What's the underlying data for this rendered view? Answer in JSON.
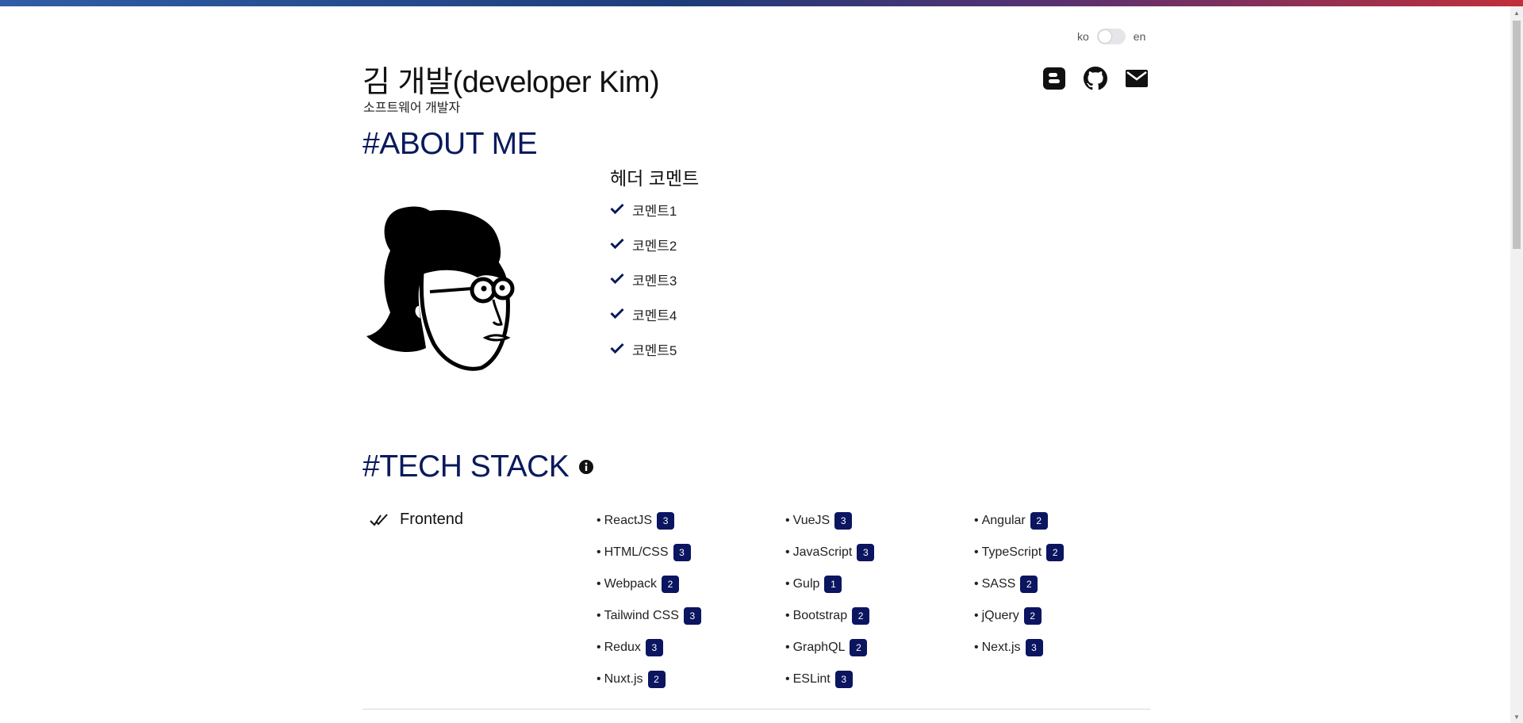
{
  "language": {
    "left": "ko",
    "right": "en"
  },
  "profile": {
    "name": "김 개발(developer Kim)",
    "subtitle": "소프트웨어 개발자"
  },
  "social": [
    {
      "icon": "blogger-icon"
    },
    {
      "icon": "github-icon"
    },
    {
      "icon": "mail-icon"
    }
  ],
  "about": {
    "title": "#ABOUT ME",
    "header_comment": "헤더 코멘트",
    "comments": [
      "코멘트1",
      "코멘트2",
      "코멘트3",
      "코멘트4",
      "코멘트5"
    ]
  },
  "tech": {
    "title": "#TECH STACK",
    "category": "Frontend",
    "skills": [
      {
        "name": "ReactJS",
        "level": "3"
      },
      {
        "name": "VueJS",
        "level": "3"
      },
      {
        "name": "Angular",
        "level": "2"
      },
      {
        "name": "HTML/CSS",
        "level": "3"
      },
      {
        "name": "JavaScript",
        "level": "3"
      },
      {
        "name": "TypeScript",
        "level": "2"
      },
      {
        "name": "Webpack",
        "level": "2"
      },
      {
        "name": "Gulp",
        "level": "1"
      },
      {
        "name": "SASS",
        "level": "2"
      },
      {
        "name": "Tailwind CSS",
        "level": "3"
      },
      {
        "name": "Bootstrap",
        "level": "2"
      },
      {
        "name": "jQuery",
        "level": "2"
      },
      {
        "name": "Redux",
        "level": "3"
      },
      {
        "name": "GraphQL",
        "level": "2"
      },
      {
        "name": "Next.js",
        "level": "3"
      },
      {
        "name": "Nuxt.js",
        "level": "2"
      },
      {
        "name": "ESLint",
        "level": "3"
      }
    ]
  },
  "colors": {
    "accent": "#0a1a5c",
    "badge": "#0b1560"
  }
}
